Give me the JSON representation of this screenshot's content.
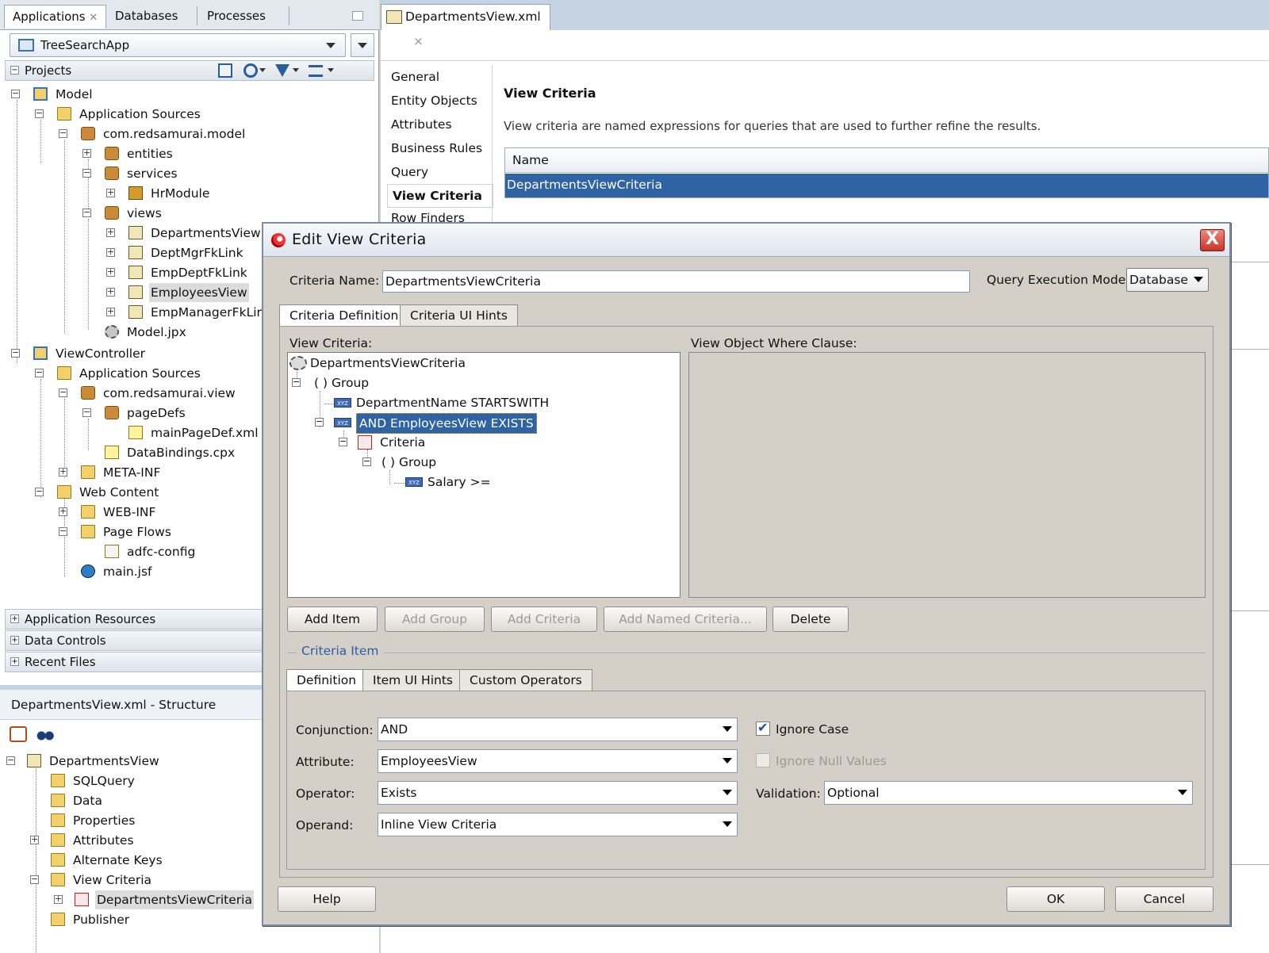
{
  "left": {
    "tabs": [
      "Applications",
      "Databases",
      "Processes"
    ],
    "app_selector": "TreeSearchApp",
    "projects_header": "Projects",
    "tree": [
      "Model",
      "Application Sources",
      "com.redsamurai.model",
      "entities",
      "services",
      "HrModule",
      "views",
      "DepartmentsView",
      "DeptMgrFkLink",
      "EmpDeptFkLink",
      "EmployeesView",
      "EmpManagerFkLink",
      "Model.jpx",
      "ViewController",
      "Application Sources",
      "com.redsamurai.view",
      "pageDefs",
      "mainPageDef.xml",
      "DataBindings.cpx",
      "META-INF",
      "Web Content",
      "WEB-INF",
      "Page Flows",
      "adfc-config",
      "main.jsf"
    ],
    "accordions": [
      "Application Resources",
      "Data Controls",
      "Recent Files"
    ],
    "structure": {
      "title": "DepartmentsView.xml - Structure",
      "tree": [
        "DepartmentsView",
        "SQLQuery",
        "Data",
        "Properties",
        "Attributes",
        "Alternate Keys",
        "View Criteria",
        "DepartmentsViewCriteria",
        "Publisher"
      ]
    }
  },
  "editor": {
    "tab": "DepartmentsView.xml",
    "close_glyph": "×",
    "nav": [
      "General",
      "Entity Objects",
      "Attributes",
      "Business Rules",
      "Query",
      "View Criteria",
      "Row Finders"
    ],
    "section_title": "View Criteria",
    "section_desc": "View criteria are named expressions for queries that are used to further refine the results.",
    "table_header": "Name",
    "table_row": "DepartmentsViewCriteria"
  },
  "dialog": {
    "title": "Edit View Criteria",
    "close_glyph": "X",
    "criteria_name_label": "Criteria Name:",
    "criteria_name_value": "DepartmentsViewCriteria",
    "query_mode_label": "Query Execution Mode:",
    "query_mode_value": "Database",
    "tabs": [
      "Criteria Definition",
      "Criteria UI Hints"
    ],
    "view_criteria_label": "View Criteria:",
    "where_clause_label": "View Object Where Clause:",
    "vc_tree": {
      "root": "DepartmentsViewCriteria",
      "group1": "( )  Group",
      "item1": "DepartmentName STARTSWITH",
      "item2": "AND EmployeesView EXISTS",
      "criteria": "Criteria",
      "group2": "( )  Group",
      "item3": "Salary >="
    },
    "buttons": [
      "Add Item",
      "Add Group",
      "Add Criteria",
      "Add Named Criteria...",
      "Delete"
    ],
    "criteria_item_label": "Criteria Item",
    "item_tabs": [
      "Definition",
      "Item UI Hints",
      "Custom Operators"
    ],
    "conjunction_label": "Conjunction:",
    "conjunction_value": "AND",
    "attribute_label": "Attribute:",
    "attribute_value": "EmployeesView",
    "operator_label": "Operator:",
    "operator_value": "Exists",
    "operand_label": "Operand:",
    "operand_value": "Inline View Criteria",
    "ignore_case_label": "Ignore Case",
    "ignore_case_checked": true,
    "ignore_null_label": "Ignore Null Values",
    "validation_label": "Validation:",
    "validation_value": "Optional",
    "help": "Help",
    "ok": "OK",
    "cancel": "Cancel"
  }
}
